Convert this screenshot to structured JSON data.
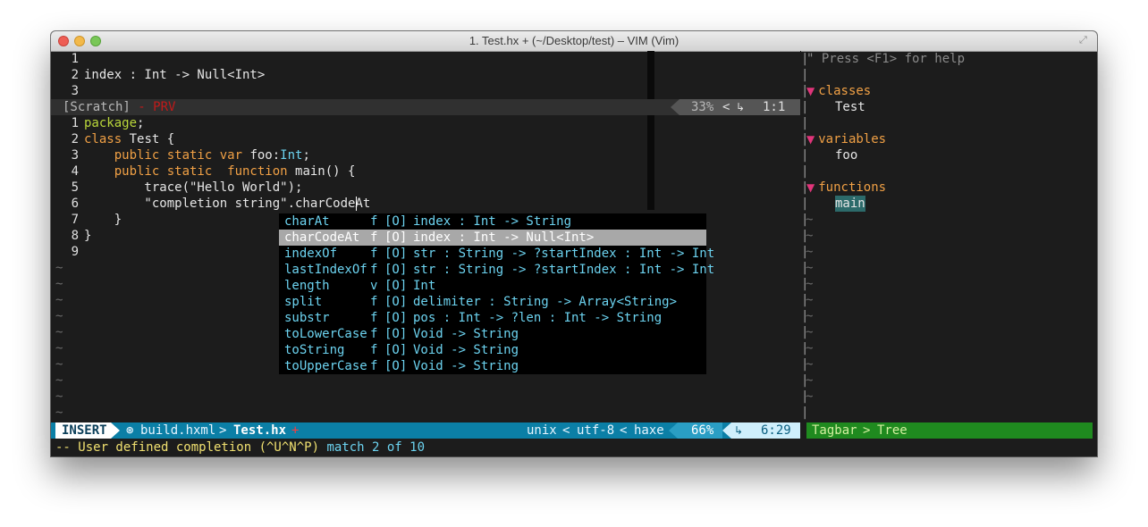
{
  "window": {
    "title": "1. Test.hx + (~/Desktop/test) – VIM (Vim)"
  },
  "scratch": {
    "lines": [
      {
        "num": "1",
        "text": ""
      },
      {
        "num": "2",
        "text": "index : Int -> Null<Int>"
      },
      {
        "num": "3",
        "text": ""
      }
    ],
    "status": {
      "name": "[Scratch]",
      "sep": " - ",
      "flag": "PRV",
      "percent": "33%",
      "branch_icon": "⭍",
      "position": "1:1"
    }
  },
  "editor": {
    "lines": [
      {
        "num": "1",
        "tokens": [
          {
            "t": "package",
            "c": "c-green"
          },
          {
            "t": ";",
            "c": "c-plain"
          }
        ]
      },
      {
        "num": "2",
        "tokens": [
          {
            "t": "class",
            "c": "c-kw"
          },
          {
            "t": " Test {",
            "c": "c-plain"
          }
        ]
      },
      {
        "num": "3",
        "tokens": [
          {
            "t": "    public static var ",
            "c": "c-kw"
          },
          {
            "t": "foo:",
            "c": "c-plain"
          },
          {
            "t": "Int",
            "c": "c-type"
          },
          {
            "t": ";",
            "c": "c-plain"
          }
        ]
      },
      {
        "num": "4",
        "tokens": [
          {
            "t": "    public static  function ",
            "c": "c-kw"
          },
          {
            "t": "main() {",
            "c": "c-plain"
          }
        ]
      },
      {
        "num": "5",
        "tokens": [
          {
            "t": "        trace(\"Hello World\");",
            "c": "c-plain"
          }
        ]
      },
      {
        "num": "6",
        "tokens": [
          {
            "t": "        \"completion string\"",
            "c": "c-plain"
          },
          {
            "t": ".charCodeAt",
            "c": "c-plain"
          }
        ]
      },
      {
        "num": "7",
        "tokens": [
          {
            "t": "    }",
            "c": "c-plain"
          }
        ]
      },
      {
        "num": "8",
        "tokens": [
          {
            "t": "}",
            "c": "c-plain"
          }
        ]
      },
      {
        "num": "9",
        "tokens": []
      }
    ],
    "tilde": "~"
  },
  "popup": {
    "items": [
      {
        "name": "charAt",
        "kind": "f",
        "menu": "[O]",
        "info": "index : Int -> String",
        "selected": false
      },
      {
        "name": "charCodeAt",
        "kind": "f",
        "menu": "[O]",
        "info": "index : Int -> Null<Int>",
        "selected": true
      },
      {
        "name": "indexOf",
        "kind": "f",
        "menu": "[O]",
        "info": "str : String -> ?startIndex : Int -> Int",
        "selected": false
      },
      {
        "name": "lastIndexOf",
        "kind": "f",
        "menu": "[O]",
        "info": "str : String -> ?startIndex : Int -> Int",
        "selected": false
      },
      {
        "name": "length",
        "kind": "v",
        "menu": "[O]",
        "info": "Int",
        "selected": false
      },
      {
        "name": "split",
        "kind": "f",
        "menu": "[O]",
        "info": "delimiter : String -> Array<String>",
        "selected": false
      },
      {
        "name": "substr",
        "kind": "f",
        "menu": "[O]",
        "info": "pos : Int -> ?len : Int -> String",
        "selected": false
      },
      {
        "name": "toLowerCase",
        "kind": "f",
        "menu": "[O]",
        "info": "Void -> String",
        "selected": false
      },
      {
        "name": "toString",
        "kind": "f",
        "menu": "[O]",
        "info": "Void -> String",
        "selected": false
      },
      {
        "name": "toUpperCase",
        "kind": "f",
        "menu": "[O]",
        "info": "Void -> String",
        "selected": false
      }
    ]
  },
  "tagbar": {
    "help": "\" Press <F1> for help",
    "sections": [
      {
        "label": "classes",
        "items": [
          "Test"
        ]
      },
      {
        "label": "variables",
        "items": [
          "foo"
        ]
      },
      {
        "label": "functions",
        "items": [
          "main"
        ]
      }
    ],
    "status": {
      "left": "Tagbar",
      "right": "Tree"
    }
  },
  "statusline": {
    "mode": "INSERT",
    "repo_icon": "⊛",
    "project": "build.hxml",
    "file": "Test.hx",
    "modified": "+",
    "fileformat": "unix",
    "encoding": "utf-8",
    "filetype": "haxe",
    "percent": "66%",
    "line_icon": "⭡",
    "position": "6:29"
  },
  "cmdline": {
    "prefix": "-- User defined completion (^U^N^P) ",
    "match": "match 2 of 10"
  },
  "colors": {
    "keyword": "#f0a045",
    "package": "#b9d63a",
    "type": "#6cd3f0",
    "mode_bg": "#ffffff",
    "status_blue": "#0b7fa6",
    "tagbar_green": "#1f8a1f",
    "tag_marker": "#e0357a"
  }
}
